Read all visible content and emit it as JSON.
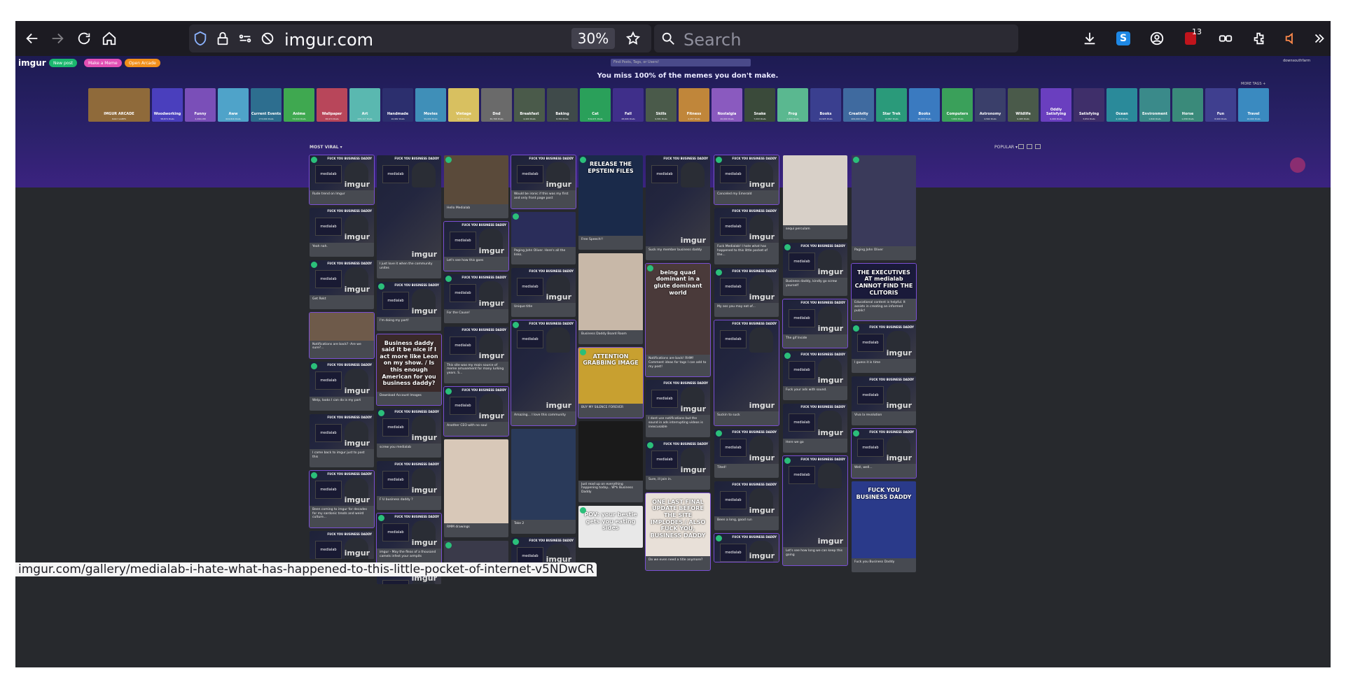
{
  "browser": {
    "url": "imgur.com",
    "zoom": "30%",
    "search_placeholder": "Search",
    "notification_count": "13",
    "status_url": "imgur.com/gallery/medialab-i-hate-what-has-happened-to-this-little-pocket-of-internet-v5NDwCR"
  },
  "site": {
    "logo": "imgur",
    "new_post": "New post",
    "make_meme": "Make a Meme",
    "open_arcade": "Open Arcade",
    "search_placeholder": "Find Posts, Tags, or Users!",
    "tagline": "You miss 100% of the memes you don't make.",
    "more_tags": "MORE TAGS +",
    "user": "downsouthfarm",
    "most_viral": "MOST VIRAL ▾",
    "popular": "POPULAR ▾"
  },
  "tags": [
    {
      "label": "IMGUR ARCADE",
      "posts": "DAILY GAMES",
      "color": "#8f6a3a"
    },
    {
      "label": "Woodworking",
      "posts": "58,874 Posts",
      "color": "#4a3fbd"
    },
    {
      "label": "Funny",
      "posts": "2,299,188",
      "color": "#7a4fb8"
    },
    {
      "label": "Aww",
      "posts": "624,816 Posts",
      "color": "#4fa3c9"
    },
    {
      "label": "Current Events",
      "posts": "173,000 Posts",
      "color": "#2d6e8f"
    },
    {
      "label": "Anime",
      "posts": "73,019 Posts",
      "color": "#3fa850"
    },
    {
      "label": "Wallpaper",
      "posts": "38,974 Posts",
      "color": "#b8465a"
    },
    {
      "label": "Art",
      "posts": "225,117 Posts",
      "color": "#5ab8b0"
    },
    {
      "label": "Handmade",
      "posts": "10,982 Posts",
      "color": "#2c2f6e"
    },
    {
      "label": "Movies",
      "posts": "59,000 Posts",
      "color": "#3f8fb8"
    },
    {
      "label": "Vintage",
      "posts": "9,476 Posts",
      "color": "#d8c060"
    },
    {
      "label": "Dnd",
      "posts": "30,768 Posts",
      "color": "#6a6a6a"
    },
    {
      "label": "Breakfast",
      "posts": "4,400 Posts",
      "color": "#4a5a4a"
    },
    {
      "label": "Baking",
      "posts": "8,394 Posts",
      "color": "#3f4a4a"
    },
    {
      "label": "Cat",
      "posts": "319,671 Posts",
      "color": "#2aa05a"
    },
    {
      "label": "Fall",
      "posts": "28,606 Posts",
      "color": "#3f2f8a"
    },
    {
      "label": "Skills",
      "posts": "9,581 Posts",
      "color": "#4a5a4a"
    },
    {
      "label": "Fitness",
      "posts": "2,457 Posts",
      "color": "#c0863a"
    },
    {
      "label": "Nostalgia",
      "posts": "20,000 Posts",
      "color": "#8a5abf"
    },
    {
      "label": "Snake",
      "posts": "7,093 Posts",
      "color": "#3a4a3a"
    },
    {
      "label": "Frog",
      "posts": "2,900 Posts",
      "color": "#5ab890"
    },
    {
      "label": "Books",
      "posts": "12,925 Posts",
      "color": "#3a3f8f"
    },
    {
      "label": "Creativity",
      "posts": "209,000 Posts",
      "color": "#3f6a9f"
    },
    {
      "label": "Star Trek",
      "posts": "10,867 Posts",
      "color": "#2a9a7a"
    },
    {
      "label": "Books",
      "posts": "30,000 Posts",
      "color": "#3a7ac0"
    },
    {
      "label": "Computers",
      "posts": "7,800 Posts",
      "color": "#3aa05a"
    },
    {
      "label": "Astronomy",
      "posts": "4,562 Posts",
      "color": "#3a3f6a"
    },
    {
      "label": "Wildlife",
      "posts": "9,465 Posts",
      "color": "#4a5a4a"
    },
    {
      "label": "Oddly Satisfying",
      "posts": "9,400 Posts",
      "color": "#6a3fbf"
    },
    {
      "label": "Satisfying",
      "posts": "3,654 Posts",
      "color": "#3f2f6a"
    },
    {
      "label": "Ocean",
      "posts": "4,100 Posts",
      "color": "#2a8a9a"
    },
    {
      "label": "Environment",
      "posts": "1,840 Posts",
      "color": "#3a8a8a"
    },
    {
      "label": "Horse",
      "posts": "1,058 Posts",
      "color": "#3a8a7a"
    },
    {
      "label": "Fun",
      "posts": "8,900 Posts",
      "color": "#3f3f8f"
    },
    {
      "label": "Travel",
      "posts": "16,000 Posts",
      "color": "#3a8ac0"
    }
  ],
  "columns": [
    [
      {
        "h": 50,
        "mm": true,
        "cap": "Rude trend on Imgur"
      },
      {
        "h": 50,
        "mm": true,
        "cap": "Yeah nah."
      },
      {
        "h": 50,
        "mm": true,
        "cap": "Get Rekt"
      },
      {
        "h": 40,
        "mm": false,
        "cap": "Notifications are back? ·Are we sure?...",
        "bg": "#6e5a4a"
      },
      {
        "h": 50,
        "mm": true,
        "cap": "Welp, looks I can do is my part"
      },
      {
        "h": 50,
        "mm": true,
        "cap": "I came back to imgur just to post this"
      },
      {
        "h": 50,
        "mm": true,
        "cap": "Been coming to imgur for decades for my sardonic treats and weird culture..."
      },
      {
        "h": 40,
        "mm": true,
        "cap": ""
      }
    ],
    [
      {
        "h": 150,
        "mm": true,
        "cap": "I just love it when the community unites"
      },
      {
        "h": 50,
        "mm": true,
        "cap": "I'm doing my part!"
      },
      {
        "h": 82,
        "mm": false,
        "cap": "Download Account Images",
        "bg": "#3a2a2a",
        "text": "Business daddy said it be nice if I act more like Leon on my show. / Is this enough American for you business daddy?"
      },
      {
        "h": 50,
        "mm": true,
        "cap": "screw you medialab"
      },
      {
        "h": 50,
        "mm": true,
        "cap": "F U business daddy ?"
      },
      {
        "h": 50,
        "mm": true,
        "cap": "imgur - May the fleas of a thousand camels infest your armpits"
      },
      {
        "h": 20,
        "mm": true,
        "cap": ""
      }
    ],
    [
      {
        "h": 70,
        "mm": false,
        "cap": "Hello Medialab",
        "bg": "#5a4a3a"
      },
      {
        "h": 50,
        "mm": true,
        "cap": "Let's see how this goes"
      },
      {
        "h": 50,
        "mm": true,
        "cap": "For the Cause!"
      },
      {
        "h": 50,
        "mm": true,
        "cap": "This site was my main source of meme amusement for many lurking years. S..."
      },
      {
        "h": 50,
        "mm": true,
        "cap": "Another CEO with no soul"
      },
      {
        "h": 120,
        "mm": false,
        "cap": "RMM drawings",
        "bg": "#d8c8b8"
      },
      {
        "h": 40,
        "mm": false,
        "cap": "",
        "bg": "#3a3a4a"
      }
    ],
    [
      {
        "h": 50,
        "mm": true,
        "cap": "Would be ironic if this was my first and only front page post"
      },
      {
        "h": 50,
        "mm": false,
        "cap": "Paging John Oliver. Here's all the links.",
        "bg": "#2a2d5a"
      },
      {
        "h": 50,
        "mm": true,
        "cap": "Unique title"
      },
      {
        "h": 130,
        "mm": true,
        "cap": "Amazing... I love this community"
      },
      {
        "h": 130,
        "mm": false,
        "cap": "Take 2",
        "bg": "#2a3a5a"
      },
      {
        "h": 40,
        "mm": true,
        "cap": ""
      }
    ],
    [
      {
        "h": 115,
        "mm": false,
        "cap": "Free Speech!!",
        "bg": "#1a2a4a",
        "text": "RELEASE THE EPSTEIN FILES"
      },
      {
        "h": 110,
        "mm": false,
        "cap": "Business Daddy Board Room",
        "bg": "#c8b8a8"
      },
      {
        "h": 80,
        "mm": false,
        "cap": "BUY MY SILENCE FOREVER",
        "bg": "#c8a030",
        "text": "ATTENTION GRABBING IMAGE"
      },
      {
        "h": 85,
        "mm": false,
        "cap": "Just read up on everything happening today... W*k Business Daddy",
        "bg": "#1a1a1a"
      },
      {
        "h": 60,
        "mm": false,
        "cap": "",
        "bg": "#e8e8e8",
        "text": "POV: your bestie gets you eating sides"
      }
    ],
    [
      {
        "h": 130,
        "mm": true,
        "cap": "Suck my member business daddy"
      },
      {
        "h": 130,
        "mm": false,
        "cap": "Notifications are back! RHM! Comment ideas for tags I can add to my post!",
        "bg": "#4a3a3a",
        "text": "being quad dominant in a glute dominant world"
      },
      {
        "h": 50,
        "mm": true,
        "cap": "I dont use notifications but the sound in ads interrupting videos is inexcusable"
      },
      {
        "h": 50,
        "mm": true,
        "cap": "Sure, ill join in."
      },
      {
        "h": 90,
        "mm": false,
        "cap": "Do we even need a title anymore?",
        "bg": "#e8e0d8",
        "text": "ONE LAST FINAL UPDATE BEFORE THE SITE IMPLODES / ALSO FUCK YOU, BUSINESS DADDY"
      }
    ],
    [
      {
        "h": 50,
        "mm": true,
        "cap": "Canceled my Emerald"
      },
      {
        "h": 50,
        "mm": true,
        "cap": "Fuck Medialab! I hate what has happened to this little pocket of the..."
      },
      {
        "h": 50,
        "mm": true,
        "cap": "My ass you may eat of..."
      },
      {
        "h": 130,
        "mm": true,
        "cap": "Suckin to suck"
      },
      {
        "h": 50,
        "mm": true,
        "cap": "Tited!"
      },
      {
        "h": 50,
        "mm": true,
        "cap": "Been a long, good run"
      },
      {
        "h": 40,
        "mm": true,
        "cap": ""
      }
    ],
    [
      {
        "h": 100,
        "mm": false,
        "cap": "sequi perculam",
        "bg": "#d8d0c8"
      },
      {
        "h": 50,
        "mm": true,
        "cap": "Business daddy, kindly go screw yourself"
      },
      {
        "h": 50,
        "mm": true,
        "cap": "The gif Inside"
      },
      {
        "h": 50,
        "mm": true,
        "cap": "Fuck your ads with sound."
      },
      {
        "h": 50,
        "mm": true,
        "cap": "Here we go"
      },
      {
        "h": 130,
        "mm": true,
        "cap": "Let's see how long we can keep this going"
      }
    ],
    [
      {
        "h": 130,
        "mm": false,
        "cap": "Paging John Oliver",
        "bg": "#3a3a5a"
      },
      {
        "h": 50,
        "mm": false,
        "cap": "Educational content is helpful. It assists in creating an informed public!",
        "bg": "#1a1a3a",
        "text": "THE EXECUTIVES AT medialab CANNOT FIND THE CLITORIS"
      },
      {
        "h": 50,
        "mm": true,
        "cap": "I guess it is time"
      },
      {
        "h": 50,
        "mm": true,
        "cap": "Viva la revolution"
      },
      {
        "h": 50,
        "mm": true,
        "cap": "Well, well..."
      },
      {
        "h": 110,
        "mm": false,
        "cap": "Fuck you Business Daddy",
        "bg": "#2a3a8a",
        "text": "FUCK YOU BUSINESS DADDY"
      }
    ]
  ]
}
